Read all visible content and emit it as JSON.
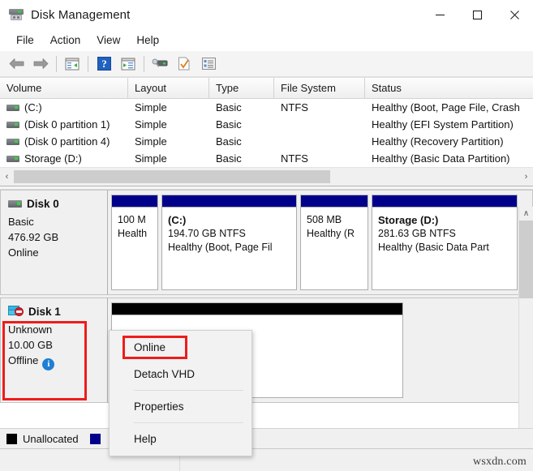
{
  "window": {
    "title": "Disk Management",
    "icon": "disk-drive-icon",
    "minimize_label": "─",
    "maximize_label": "□",
    "close_label": "✕"
  },
  "menubar": {
    "items": [
      {
        "label": "File"
      },
      {
        "label": "Action"
      },
      {
        "label": "View"
      },
      {
        "label": "Help"
      }
    ]
  },
  "toolbar": {
    "items": [
      {
        "name": "back-arrow-icon",
        "label": "Back"
      },
      {
        "name": "forward-arrow-icon",
        "label": "Forward"
      },
      {
        "name": "show-hide-console-tree-icon",
        "label": "Show/Hide Console Tree"
      },
      {
        "name": "help-icon",
        "label": "Help"
      },
      {
        "name": "show-hide-action-pane-icon",
        "label": "Show/Hide Action Pane"
      },
      {
        "name": "rescan-disks-icon",
        "label": "Rescan Disks"
      },
      {
        "name": "properties-icon",
        "label": "Properties"
      },
      {
        "name": "list-view-icon",
        "label": "List View"
      }
    ]
  },
  "volume_table": {
    "columns": [
      "Volume",
      "Layout",
      "Type",
      "File System",
      "Status"
    ],
    "rows": [
      {
        "volume": "(C:)",
        "layout": "Simple",
        "type": "Basic",
        "file_system": "NTFS",
        "status": "Healthy (Boot, Page File, Crash"
      },
      {
        "volume": "(Disk 0 partition 1)",
        "layout": "Simple",
        "type": "Basic",
        "file_system": "",
        "status": "Healthy (EFI System Partition)"
      },
      {
        "volume": "(Disk 0 partition 4)",
        "layout": "Simple",
        "type": "Basic",
        "file_system": "",
        "status": "Healthy (Recovery Partition)"
      },
      {
        "volume": "Storage (D:)",
        "layout": "Simple",
        "type": "Basic",
        "file_system": "NTFS",
        "status": "Healthy (Basic Data Partition)"
      }
    ]
  },
  "horizontal_scrollbar": {
    "left_arrow": "‹",
    "right_arrow": "›"
  },
  "vertical_scrollbar": {
    "up_arrow": "∧",
    "down_arrow": "∨"
  },
  "disks": [
    {
      "name": "Disk 0",
      "icon": "disk-drive-icon",
      "type": "Basic",
      "capacity": "476.92 GB",
      "state": "Online",
      "partitions": [
        {
          "name": "",
          "size": "100 M",
          "status": "Health",
          "bar_color": "#00008b"
        },
        {
          "name": "(C:)",
          "size": "194.70 GB NTFS",
          "status": "Healthy (Boot, Page Fil",
          "bar_color": "#00008b"
        },
        {
          "name": "",
          "size": "508 MB",
          "status": "Healthy (R",
          "bar_color": "#00008b"
        },
        {
          "name": "Storage  (D:)",
          "size": "281.63 GB NTFS",
          "status": "Healthy (Basic Data Part",
          "bar_color": "#00008b"
        }
      ]
    },
    {
      "name": "Disk 1",
      "icon": "vhd-offline-icon",
      "type": "Unknown",
      "capacity": "10.00 GB",
      "state": "Offline",
      "state_badge": "i",
      "partitions": [
        {
          "name": "",
          "size": "",
          "status": "",
          "bar_color": "#000000"
        }
      ]
    }
  ],
  "context_menu": {
    "items": [
      {
        "label": "Online",
        "highlighted": true
      },
      {
        "label": "Detach VHD",
        "highlighted": false
      },
      {
        "separator_after": true
      },
      {
        "label": "Properties",
        "highlighted": false
      },
      {
        "separator_after": true
      },
      {
        "label": "Help",
        "highlighted": false
      }
    ]
  },
  "legend": {
    "items": [
      {
        "label": "Unallocated",
        "color": "#000000"
      },
      {
        "label": "",
        "color": "#00008b"
      }
    ]
  },
  "watermark": {
    "text": "wsxdn.com"
  },
  "colors": {
    "highlight_red": "#ee1c1c",
    "primary_partition_blue": "#00008b",
    "unallocated_black": "#000000",
    "info_badge_blue": "#1e7fd4"
  }
}
